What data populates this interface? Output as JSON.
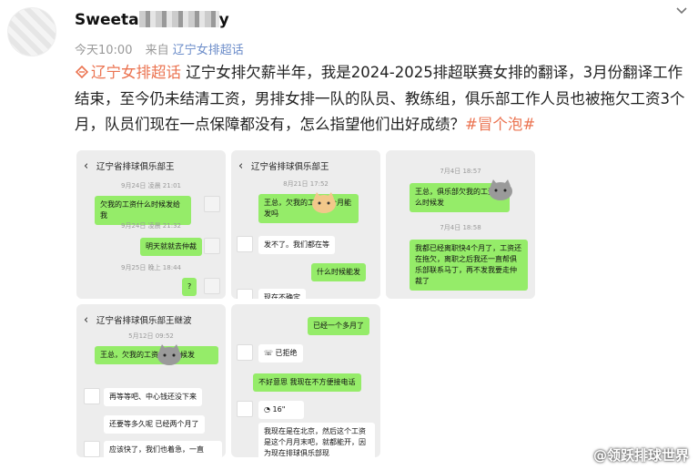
{
  "post": {
    "username_visible": "Sweeta",
    "username_tail": "y",
    "time": "今天10:00",
    "source_prefix": "来自",
    "source": "辽宁女排超话",
    "topic_tag": "辽宁女排超话",
    "body": "辽宁女排欠薪半年，我是2024-2025排超联赛女排的翻译，3月份翻译工作结束，至今仍未结清工资，男排女排一队的队员、教练组，俱乐部工作人员也被拖欠工资3个月，队员们现在一点保障都没有，怎么指望他们出好成绩？",
    "hashtag": "#冒个泡#"
  },
  "screenshots": {
    "s1": {
      "title": "辽宁省排球俱乐部王",
      "t1": "9月24日 凌晨 21:01",
      "m1": "欠我的工资什么时候发给我",
      "t2": "9月24日 凌晨 21:32",
      "m2": "明天就就去仲裁",
      "t3": "9月25日 晚上 18:44",
      "m3": "?"
    },
    "s2": {
      "title": "辽宁省排球俱乐部王",
      "t1": "8月21日 17:52",
      "m1": "王总，欠我的工资这个月能发吗",
      "m2": "发不了。我们都在等",
      "m3": "什么时候能发",
      "m4": "现在不确定"
    },
    "s3": {
      "t1": "7月4日 18:57",
      "m1": "王总，俱乐部欠我的工资什么时候发",
      "t2": "7月4日 18:58",
      "m2": "我都已经离职快4个月了，工资还在拖欠，离职之后我还一直帮俱乐部联系马丁，再不发我要走仲裁了"
    },
    "s4": {
      "title": "辽宁省排球俱乐部王继波",
      "t1": "5月12日 09:52",
      "m1": "王总，欠我的工资什么时候发",
      "m2": "再等等吧、中心钱还没下来",
      "m3": "还要等多久呢 已经两个月了",
      "m4": "应该快了，我们也着急，一直"
    },
    "s5": {
      "m1": "已经一个多月了",
      "m2": "已拒绝",
      "m3": "不好意思 我现在不方便接电话",
      "m4": "16\"",
      "m5": "我现在是在北京，然后这个工资是这个月月末吧，就都能开，因为现在排球俱乐部现"
    }
  },
  "watermark": "@领跃排球世界"
}
